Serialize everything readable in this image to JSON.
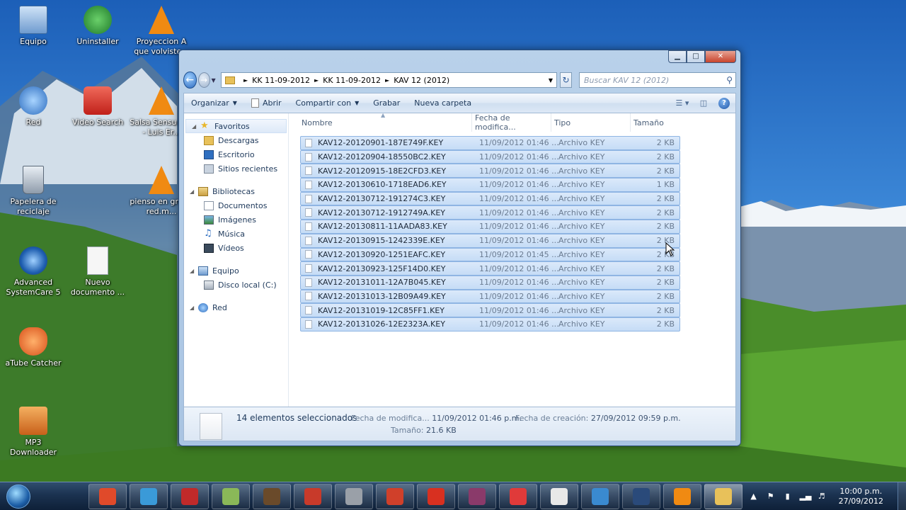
{
  "desktop": {
    "icons": [
      {
        "label": "Equipo",
        "icon": "computer-icon",
        "color": "#8ab4e0"
      },
      {
        "label": "Uninstaller",
        "icon": "uninstaller-icon",
        "color": "#3a9a3a"
      },
      {
        "label": "Proyeccion  A que volviste...",
        "icon": "vlc-icon",
        "color": "#f08a12"
      },
      {
        "label": "Red",
        "icon": "network-icon",
        "color": "#4a8ed8"
      },
      {
        "label": "Video Search",
        "icon": "youtube-icon",
        "color": "#d8302a"
      },
      {
        "label": "Salsa Sensu Ella - Luis Er...",
        "icon": "vlc-icon",
        "color": "#f08a12"
      },
      {
        "label": "Papelera de reciclaje",
        "icon": "recycle-bin-icon",
        "color": "#9aa8b8"
      },
      {
        "label": "pienso en grupo red.m...",
        "icon": "vlc-icon",
        "color": "#f08a12"
      },
      {
        "label": "Advanced SystemCare 5",
        "icon": "systemcare-icon",
        "color": "#2a6ad0"
      },
      {
        "label": "Nuevo documento ...",
        "icon": "text-document-icon",
        "color": "#f5f5f5"
      },
      {
        "label": "aTube Catcher",
        "icon": "atube-icon",
        "color": "#e8601a"
      },
      {
        "label": "MP3 Downloader",
        "icon": "mp3-downloader-icon",
        "color": "#e0802a"
      }
    ]
  },
  "window": {
    "controls": {
      "minimize": "▁",
      "maximize": "□",
      "close": "✕"
    },
    "address": {
      "crumbs": [
        "KK 11-09-2012",
        "KK 11-09-2012",
        "KAV 12 (2012)"
      ]
    },
    "search": {
      "placeholder": "Buscar KAV 12 (2012)"
    },
    "toolbar": {
      "organize": "Organizar",
      "open": "Abrir",
      "share": "Compartir con",
      "burn": "Grabar",
      "new_folder": "Nueva carpeta"
    },
    "nav": {
      "favorites": "Favoritos",
      "downloads": "Descargas",
      "desktop": "Escritorio",
      "recent": "Sitios recientes",
      "libraries": "Bibliotecas",
      "documents": "Documentos",
      "images": "Imágenes",
      "music": "Música",
      "videos": "Vídeos",
      "computer": "Equipo",
      "local_disk": "Disco local (C:)",
      "network": "Red"
    },
    "columns": {
      "name": "Nombre",
      "date": "Fecha de modifica...",
      "type": "Tipo",
      "size": "Tamaño"
    },
    "files": [
      {
        "name": "KAV12-20120901-187E749F.KEY",
        "date": "11/09/2012 01:46 ...",
        "type": "Archivo KEY",
        "size": "2 KB"
      },
      {
        "name": "KAV12-20120904-18550BC2.KEY",
        "date": "11/09/2012 01:46 ...",
        "type": "Archivo KEY",
        "size": "2 KB"
      },
      {
        "name": "KAV12-20120915-18E2CFD3.KEY",
        "date": "11/09/2012 01:46 ...",
        "type": "Archivo KEY",
        "size": "2 KB"
      },
      {
        "name": "KAV12-20130610-1718EAD6.KEY",
        "date": "11/09/2012 01:46 ...",
        "type": "Archivo KEY",
        "size": "1 KB"
      },
      {
        "name": "KAV12-20130712-191274C3.KEY",
        "date": "11/09/2012 01:46 ...",
        "type": "Archivo KEY",
        "size": "2 KB"
      },
      {
        "name": "KAV12-20130712-1912749A.KEY",
        "date": "11/09/2012 01:46 ...",
        "type": "Archivo KEY",
        "size": "2 KB"
      },
      {
        "name": "KAV12-20130811-11AADA83.KEY",
        "date": "11/09/2012 01:46 ...",
        "type": "Archivo KEY",
        "size": "2 KB"
      },
      {
        "name": "KAV12-20130915-1242339E.KEY",
        "date": "11/09/2012 01:46 ...",
        "type": "Archivo KEY",
        "size": "2 KB"
      },
      {
        "name": "KAV12-20130920-1251EAFC.KEY",
        "date": "11/09/2012 01:45 ...",
        "type": "Archivo KEY",
        "size": "2 KB"
      },
      {
        "name": "KAV12-20130923-125F14D0.KEY",
        "date": "11/09/2012 01:46 ...",
        "type": "Archivo KEY",
        "size": "2 KB"
      },
      {
        "name": "KAV12-20131011-12A7B045.KEY",
        "date": "11/09/2012 01:46 ...",
        "type": "Archivo KEY",
        "size": "2 KB"
      },
      {
        "name": "KAV12-20131013-12B09A49.KEY",
        "date": "11/09/2012 01:46 ...",
        "type": "Archivo KEY",
        "size": "2 KB"
      },
      {
        "name": "KAV12-20131019-12C85FF1.KEY",
        "date": "11/09/2012 01:46 ...",
        "type": "Archivo KEY",
        "size": "2 KB"
      },
      {
        "name": "KAV12-20131026-12E2323A.KEY",
        "date": "11/09/2012 01:46 ...",
        "type": "Archivo KEY",
        "size": "2 KB"
      }
    ],
    "details": {
      "count": "14 elementos seleccionados",
      "modified_label": "Fecha de modifica...",
      "modified_value": "11/09/2012 01:46 p.m.",
      "size_label": "Tamaño:",
      "size_value": "21.6 KB",
      "created_label": "Fecha de creación:",
      "created_value": "27/09/2012 09:59 p.m."
    }
  },
  "taskbar": {
    "apps": [
      {
        "icon": "chrome-icon",
        "color": "#e04a2a"
      },
      {
        "icon": "windows-live-icon",
        "color": "#3a9ad8"
      },
      {
        "icon": "malwarebytes-icon",
        "color": "#c02a2a"
      },
      {
        "icon": "notes-icon",
        "color": "#8ab858"
      },
      {
        "icon": "game-character-icon",
        "color": "#6a4a2a"
      },
      {
        "icon": "red-app-icon",
        "color": "#c83a2a"
      },
      {
        "icon": "counter-strike-icon",
        "color": "#9aa0a8"
      },
      {
        "icon": "ccleaner-icon",
        "color": "#d0402a"
      },
      {
        "icon": "gear-app-icon",
        "color": "#d83020"
      },
      {
        "icon": "winrar-shield-icon",
        "color": "#8a3a6a"
      },
      {
        "icon": "zip-app-icon",
        "color": "#e03a3a"
      },
      {
        "icon": "gamepad-icon",
        "color": "#e8e8e8"
      },
      {
        "icon": "systemcare-shield-icon",
        "color": "#3a8ad0"
      },
      {
        "icon": "monitor-app-icon",
        "color": "#2a4a7a"
      },
      {
        "icon": "vlc-icon",
        "color": "#f08a12"
      },
      {
        "icon": "explorer-folder-icon",
        "color": "#e8c15a"
      }
    ],
    "clock": {
      "time": "10:00 p.m.",
      "date": "27/09/2012"
    }
  }
}
